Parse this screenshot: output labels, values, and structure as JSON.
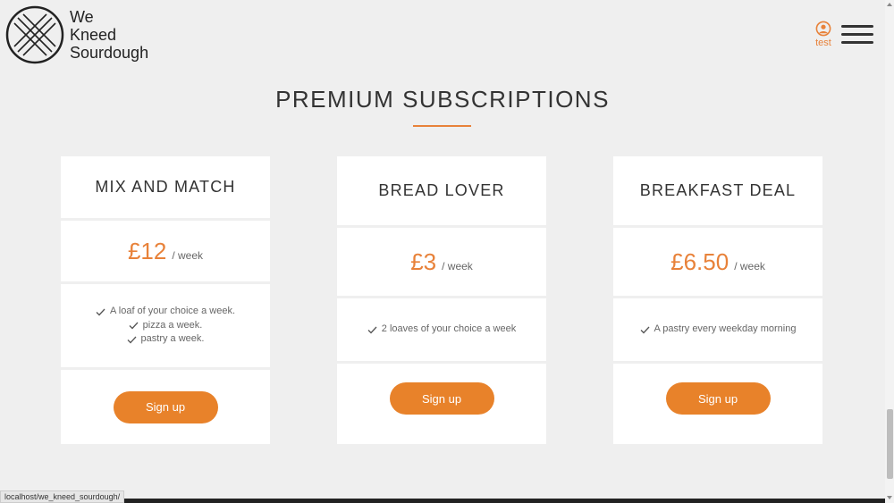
{
  "header": {
    "logo_lines": [
      "We",
      "Kneed",
      "Sourdough"
    ],
    "user_name": "test",
    "menu_icon": "hamburger-menu-icon",
    "user_icon": "user-circle-icon",
    "accent_color": "#e8823a"
  },
  "page": {
    "title": "PREMIUM SUBSCRIPTIONS"
  },
  "plans": [
    {
      "title": "MIX AND MATCH",
      "price": "£12",
      "period": "/ week",
      "features": [
        "A loaf of your choice a week.",
        "pizza a week.",
        "pastry a week."
      ],
      "button": "Sign up"
    },
    {
      "title": "BREAD LOVER",
      "price": "£3",
      "period": "/ week",
      "features": [
        "2 loaves of your choice a week"
      ],
      "button": "Sign up"
    },
    {
      "title": "BREAKFAST DEAL",
      "price": "£6.50",
      "period": "/ week",
      "features": [
        "A pastry every weekday morning"
      ],
      "button": "Sign up"
    }
  ],
  "status_bar": {
    "url": "localhost/we_kneed_sourdough/"
  }
}
